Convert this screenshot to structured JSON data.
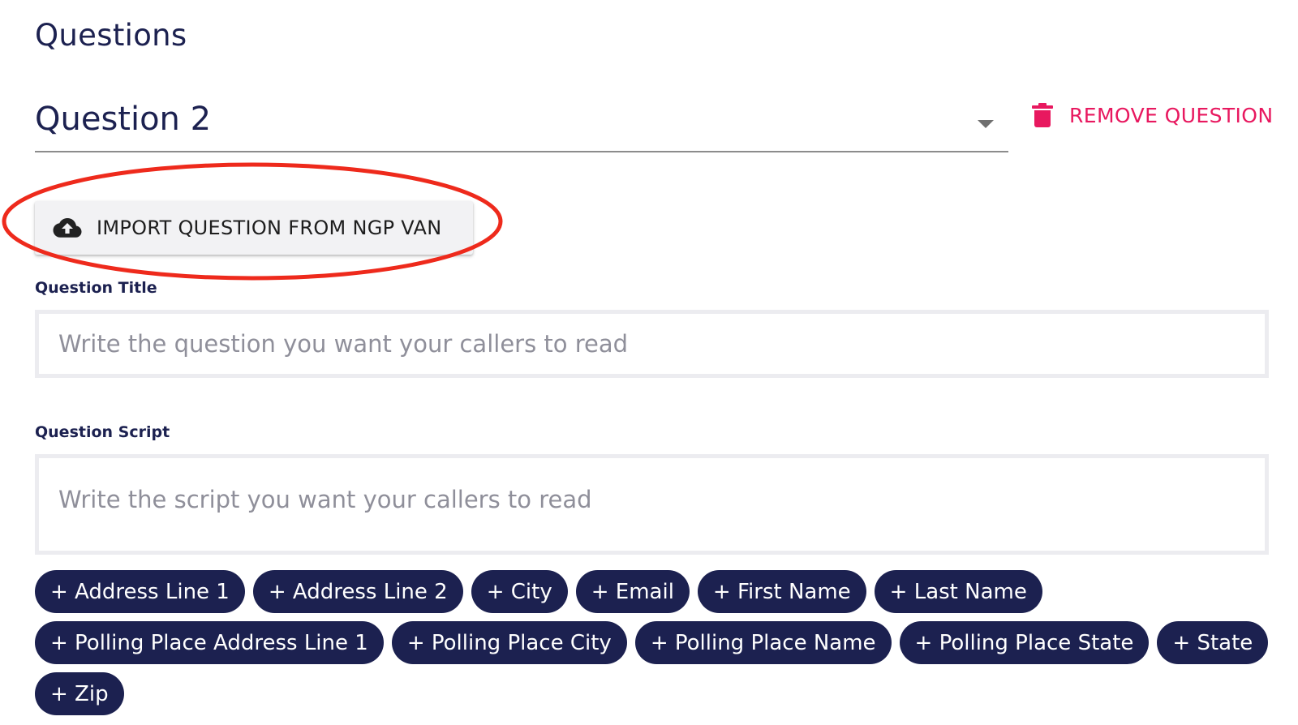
{
  "page": {
    "section_title": "Questions"
  },
  "question_select": {
    "value": "Question 2"
  },
  "remove_button": {
    "label": "REMOVE QUESTION",
    "icon": "trash-icon",
    "color": "#e8185f"
  },
  "import_button": {
    "label": "IMPORT QUESTION FROM NGP VAN",
    "icon": "cloud-upload-icon"
  },
  "question_title": {
    "label": "Question Title",
    "value": "",
    "placeholder": "Write the question you want your callers to read"
  },
  "question_script": {
    "label": "Question Script",
    "value": "",
    "placeholder": "Write the script you want your callers to read"
  },
  "variable_chips": [
    "+ Address Line 1",
    "+ Address Line 2",
    "+ City",
    "+ Email",
    "+ First Name",
    "+ Last Name",
    "+ Polling Place Address Line 1",
    "+ Polling Place City",
    "+ Polling Place Name",
    "+ Polling Place State",
    "+ State",
    "+ Zip"
  ],
  "colors": {
    "primary": "#1c2150",
    "danger": "#e8185f",
    "annotation": "#ee2a1c"
  }
}
